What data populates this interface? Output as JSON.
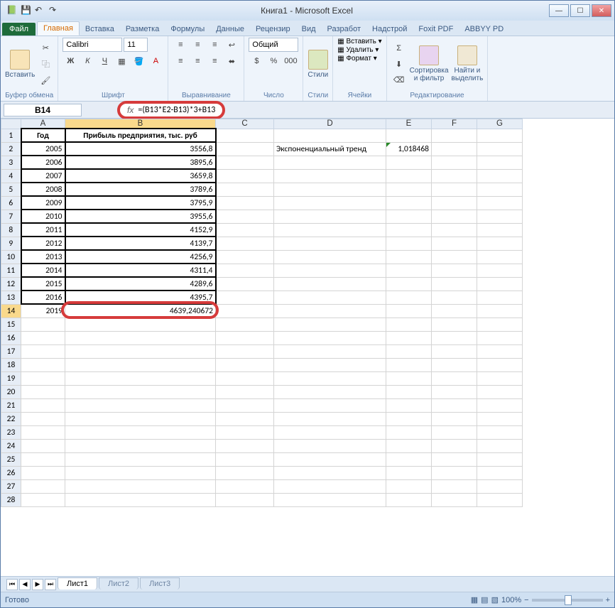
{
  "title": "Книга1 - Microsoft Excel",
  "tabs": {
    "file": "Файл",
    "list": [
      "Главная",
      "Вставка",
      "Разметка",
      "Формулы",
      "Данные",
      "Рецензир",
      "Вид",
      "Разработ",
      "Надстрой",
      "Foxit PDF",
      "ABBYY PD"
    ],
    "active": 0
  },
  "ribbon": {
    "clipboard": {
      "label": "Буфер обмена",
      "paste": "Вставить"
    },
    "font": {
      "label": "Шрифт",
      "name": "Calibri",
      "size": "11"
    },
    "align": {
      "label": "Выравнивание"
    },
    "number": {
      "label": "Число",
      "format": "Общий"
    },
    "styles": {
      "label": "Стили",
      "btn": "Стили"
    },
    "cells": {
      "label": "Ячейки",
      "insert": "Вставить",
      "delete": "Удалить",
      "format": "Формат"
    },
    "editing": {
      "label": "Редактирование",
      "sort": "Сортировка\nи фильтр",
      "find": "Найти и\nвыделить"
    }
  },
  "namebox": "B14",
  "formula": "=(B13*E2-B13)*3+B13",
  "fx_label": "fx",
  "columns": [
    "A",
    "B",
    "C",
    "D",
    "E",
    "F",
    "G"
  ],
  "headers": {
    "A": "Год",
    "B": "Прибыль предприятия, тыс. руб"
  },
  "rows": [
    {
      "n": 2,
      "A": "2005",
      "B": "3556,8",
      "D": "Экспоненциальный тренд",
      "E": "1,018468"
    },
    {
      "n": 3,
      "A": "2006",
      "B": "3895,6"
    },
    {
      "n": 4,
      "A": "2007",
      "B": "3659,8"
    },
    {
      "n": 5,
      "A": "2008",
      "B": "3789,6"
    },
    {
      "n": 6,
      "A": "2009",
      "B": "3795,9"
    },
    {
      "n": 7,
      "A": "2010",
      "B": "3955,6"
    },
    {
      "n": 8,
      "A": "2011",
      "B": "4152,9"
    },
    {
      "n": 9,
      "A": "2012",
      "B": "4139,7"
    },
    {
      "n": 10,
      "A": "2013",
      "B": "4256,9"
    },
    {
      "n": 11,
      "A": "2014",
      "B": "4311,4"
    },
    {
      "n": 12,
      "A": "2015",
      "B": "4289,6"
    },
    {
      "n": 13,
      "A": "2016",
      "B": "4395,7"
    },
    {
      "n": 14,
      "A": "2019",
      "B": "4639,240672"
    }
  ],
  "empty_rows": [
    15,
    16,
    17,
    18,
    19,
    20,
    21,
    22,
    23,
    24,
    25,
    26,
    27,
    28
  ],
  "sheets": [
    "Лист1",
    "Лист2",
    "Лист3"
  ],
  "status": {
    "ready": "Готово",
    "zoom": "100%"
  }
}
